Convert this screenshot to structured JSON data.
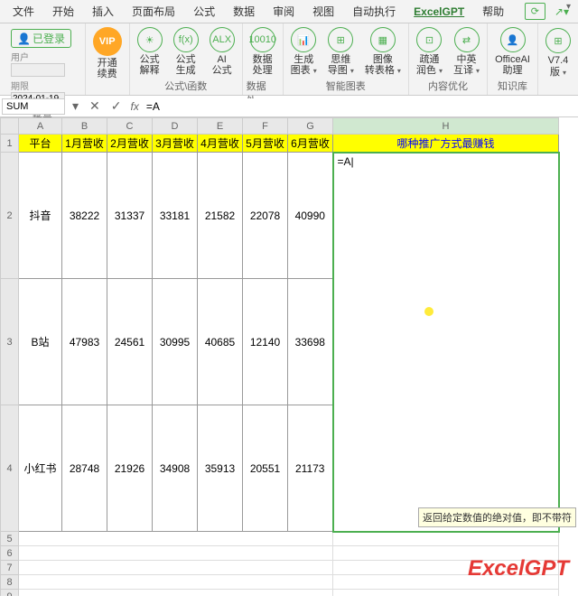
{
  "menu": {
    "items": [
      "文件",
      "开始",
      "插入",
      "页面布局",
      "公式",
      "数据",
      "审阅",
      "视图",
      "自动执行",
      "ExcelGPT",
      "帮助"
    ],
    "active": 9,
    "refresh": "⟳",
    "share": "↗"
  },
  "account": {
    "login": "已登录",
    "user_lbl": "用户",
    "user_val": "",
    "date_lbl": "期限",
    "date_val": "2024-01-19",
    "group": "账号"
  },
  "ribbon": {
    "vip": "VIP",
    "vip_lbl": "开通\n续费",
    "formula": [
      {
        "t": "☀",
        "l": "公式\n解释"
      },
      {
        "t": "f(x)",
        "l": "公式\n生成"
      },
      {
        "t": "ALX",
        "l": "AI\n公式"
      }
    ],
    "formula_g": "公式\\函数",
    "data": [
      {
        "t": "10010",
        "l": "数据\n处理"
      }
    ],
    "data_g": "数据处...",
    "smart": [
      {
        "t": "📊",
        "l": "生成\n图表"
      },
      {
        "t": "⊞",
        "l": "思维\n导图"
      },
      {
        "t": "▦",
        "l": "图像\n转表格"
      }
    ],
    "smart_g": "智能图表",
    "content": [
      {
        "t": "⊡",
        "l": "疏通\n润色"
      },
      {
        "t": "⇄",
        "l": "中英\n互译"
      }
    ],
    "content_g": "内容优化",
    "know": [
      {
        "t": "👤",
        "l": "OfficeAI\n助理"
      }
    ],
    "know_g": "知识库",
    "ver": [
      {
        "t": "⊞",
        "l": "V7.4\n版"
      }
    ]
  },
  "formula": {
    "name": "SUM",
    "cancel": "✕",
    "ok": "✓",
    "fx": "fx",
    "value": "=A"
  },
  "cols": [
    "A",
    "B",
    "C",
    "D",
    "E",
    "F",
    "G",
    "H"
  ],
  "headers": [
    "平台",
    "1月营收",
    "2月营收",
    "3月营收",
    "4月营收",
    "5月营收",
    "6月营收"
  ],
  "headerH": "哪种推广方式最赚钱",
  "rows": [
    {
      "p": "抖音",
      "v": [
        "38222",
        "31337",
        "33181",
        "21582",
        "22078",
        "40990"
      ]
    },
    {
      "p": "B站",
      "v": [
        "47983",
        "24561",
        "30995",
        "40685",
        "12140",
        "33698"
      ]
    },
    {
      "p": "小红书",
      "v": [
        "28748",
        "21926",
        "34908",
        "35913",
        "20551",
        "21173"
      ]
    }
  ],
  "editcell": "=A",
  "tooltip": "返回给定数值的绝对值，即不带符",
  "brand": "ExcelGPT"
}
